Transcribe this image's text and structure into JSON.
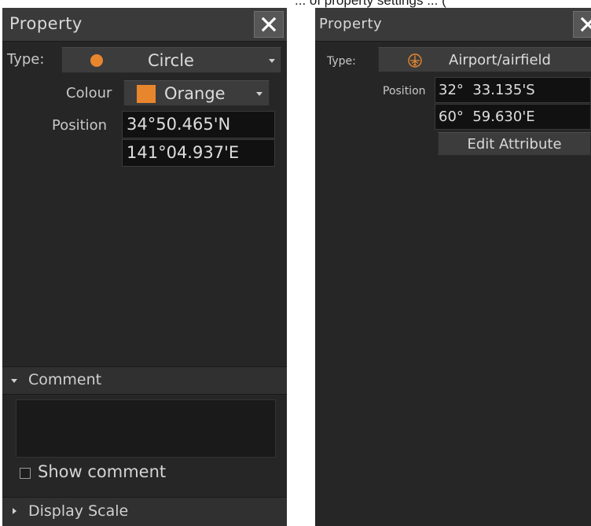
{
  "caption_fragment": "... of property settings ... (",
  "left_panel": {
    "title": "Property",
    "type_label": "Type:",
    "type_value": "Circle",
    "colour_label": "Colour",
    "colour_value": "Orange",
    "colour_swatch": "#e8862e",
    "type_icon_color": "#e8862e",
    "position_label": "Position",
    "latitude": "34°50.465'N",
    "longitude": "141°04.937'E",
    "comment_label": "Comment",
    "comment_value": "",
    "show_comment_label": "Show comment",
    "show_comment_checked": false,
    "display_scale_label": "Display Scale"
  },
  "right_panel": {
    "title": "Property",
    "type_label": "Type:",
    "type_value": "Airport/airfield",
    "type_icon": "airport-icon",
    "position_label": "Position",
    "latitude": "32°  33.135'S",
    "longitude": "60°  59.630'E",
    "edit_attribute_label": "Edit Attribute"
  },
  "colors": {
    "panel_bg": "#262626",
    "title_bg": "#3a3a3a",
    "field_bg": "#111111",
    "accent_orange": "#e8862e"
  }
}
